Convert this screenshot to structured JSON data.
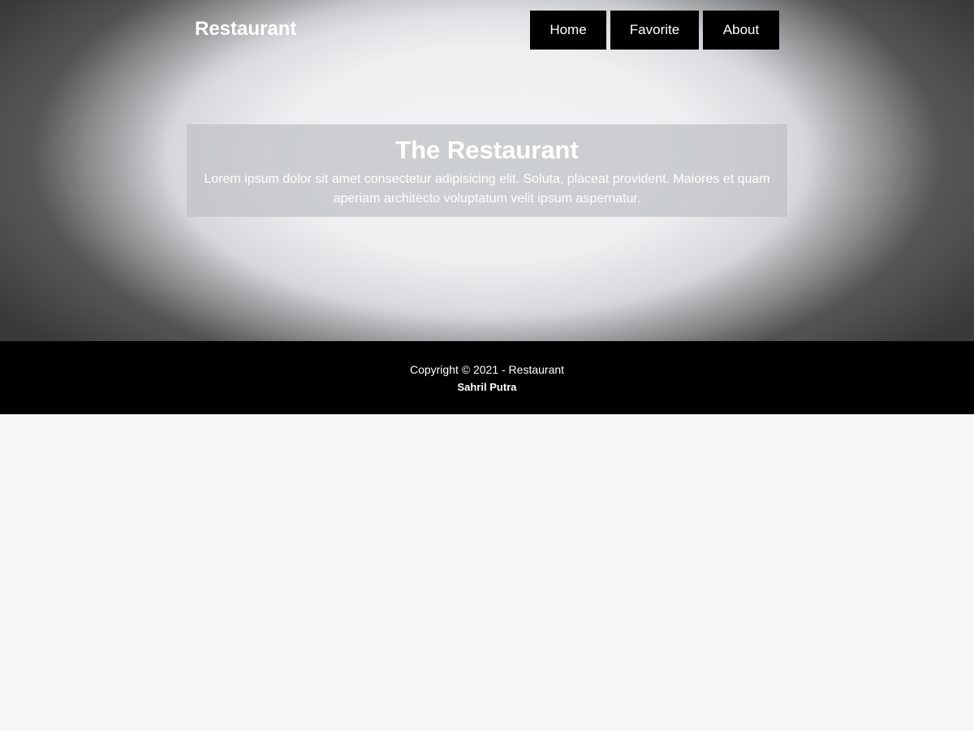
{
  "header": {
    "brand": "Restaurant",
    "nav": {
      "home": "Home",
      "favorite": "Favorite",
      "about": "About"
    }
  },
  "hero": {
    "title": "The Restaurant",
    "description": "Lorem ipsum dolor sit amet consectetur adipisicing elit. Soluta, placeat provident. Maiores et quam aperiam architecto voluptatum velit ipsum aspernatur."
  },
  "footer": {
    "copyright": "Copyright © 2021 - Restaurant",
    "author": "Sahril Putra"
  },
  "colors": {
    "nav_background": "#000000",
    "footer_background": "#000000",
    "page_background": "#f4f6f8",
    "text_light": "#ffffff"
  }
}
